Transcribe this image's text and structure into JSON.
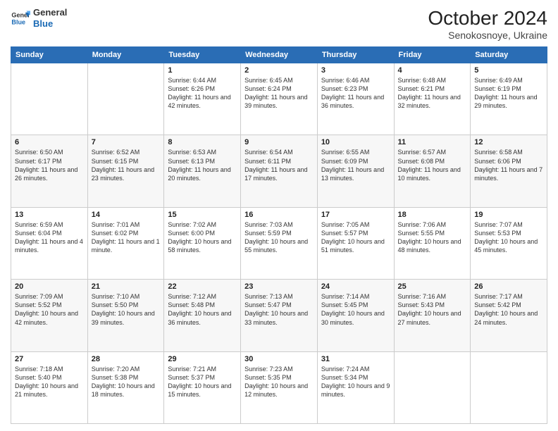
{
  "logo": {
    "line1": "General",
    "line2": "Blue"
  },
  "title": "October 2024",
  "location": "Senokosnoye, Ukraine",
  "days_of_week": [
    "Sunday",
    "Monday",
    "Tuesday",
    "Wednesday",
    "Thursday",
    "Friday",
    "Saturday"
  ],
  "weeks": [
    [
      {
        "day": "",
        "info": ""
      },
      {
        "day": "",
        "info": ""
      },
      {
        "day": "1",
        "info": "Sunrise: 6:44 AM\nSunset: 6:26 PM\nDaylight: 11 hours and 42 minutes."
      },
      {
        "day": "2",
        "info": "Sunrise: 6:45 AM\nSunset: 6:24 PM\nDaylight: 11 hours and 39 minutes."
      },
      {
        "day": "3",
        "info": "Sunrise: 6:46 AM\nSunset: 6:23 PM\nDaylight: 11 hours and 36 minutes."
      },
      {
        "day": "4",
        "info": "Sunrise: 6:48 AM\nSunset: 6:21 PM\nDaylight: 11 hours and 32 minutes."
      },
      {
        "day": "5",
        "info": "Sunrise: 6:49 AM\nSunset: 6:19 PM\nDaylight: 11 hours and 29 minutes."
      }
    ],
    [
      {
        "day": "6",
        "info": "Sunrise: 6:50 AM\nSunset: 6:17 PM\nDaylight: 11 hours and 26 minutes."
      },
      {
        "day": "7",
        "info": "Sunrise: 6:52 AM\nSunset: 6:15 PM\nDaylight: 11 hours and 23 minutes."
      },
      {
        "day": "8",
        "info": "Sunrise: 6:53 AM\nSunset: 6:13 PM\nDaylight: 11 hours and 20 minutes."
      },
      {
        "day": "9",
        "info": "Sunrise: 6:54 AM\nSunset: 6:11 PM\nDaylight: 11 hours and 17 minutes."
      },
      {
        "day": "10",
        "info": "Sunrise: 6:55 AM\nSunset: 6:09 PM\nDaylight: 11 hours and 13 minutes."
      },
      {
        "day": "11",
        "info": "Sunrise: 6:57 AM\nSunset: 6:08 PM\nDaylight: 11 hours and 10 minutes."
      },
      {
        "day": "12",
        "info": "Sunrise: 6:58 AM\nSunset: 6:06 PM\nDaylight: 11 hours and 7 minutes."
      }
    ],
    [
      {
        "day": "13",
        "info": "Sunrise: 6:59 AM\nSunset: 6:04 PM\nDaylight: 11 hours and 4 minutes."
      },
      {
        "day": "14",
        "info": "Sunrise: 7:01 AM\nSunset: 6:02 PM\nDaylight: 11 hours and 1 minute."
      },
      {
        "day": "15",
        "info": "Sunrise: 7:02 AM\nSunset: 6:00 PM\nDaylight: 10 hours and 58 minutes."
      },
      {
        "day": "16",
        "info": "Sunrise: 7:03 AM\nSunset: 5:59 PM\nDaylight: 10 hours and 55 minutes."
      },
      {
        "day": "17",
        "info": "Sunrise: 7:05 AM\nSunset: 5:57 PM\nDaylight: 10 hours and 51 minutes."
      },
      {
        "day": "18",
        "info": "Sunrise: 7:06 AM\nSunset: 5:55 PM\nDaylight: 10 hours and 48 minutes."
      },
      {
        "day": "19",
        "info": "Sunrise: 7:07 AM\nSunset: 5:53 PM\nDaylight: 10 hours and 45 minutes."
      }
    ],
    [
      {
        "day": "20",
        "info": "Sunrise: 7:09 AM\nSunset: 5:52 PM\nDaylight: 10 hours and 42 minutes."
      },
      {
        "day": "21",
        "info": "Sunrise: 7:10 AM\nSunset: 5:50 PM\nDaylight: 10 hours and 39 minutes."
      },
      {
        "day": "22",
        "info": "Sunrise: 7:12 AM\nSunset: 5:48 PM\nDaylight: 10 hours and 36 minutes."
      },
      {
        "day": "23",
        "info": "Sunrise: 7:13 AM\nSunset: 5:47 PM\nDaylight: 10 hours and 33 minutes."
      },
      {
        "day": "24",
        "info": "Sunrise: 7:14 AM\nSunset: 5:45 PM\nDaylight: 10 hours and 30 minutes."
      },
      {
        "day": "25",
        "info": "Sunrise: 7:16 AM\nSunset: 5:43 PM\nDaylight: 10 hours and 27 minutes."
      },
      {
        "day": "26",
        "info": "Sunrise: 7:17 AM\nSunset: 5:42 PM\nDaylight: 10 hours and 24 minutes."
      }
    ],
    [
      {
        "day": "27",
        "info": "Sunrise: 7:18 AM\nSunset: 5:40 PM\nDaylight: 10 hours and 21 minutes."
      },
      {
        "day": "28",
        "info": "Sunrise: 7:20 AM\nSunset: 5:38 PM\nDaylight: 10 hours and 18 minutes."
      },
      {
        "day": "29",
        "info": "Sunrise: 7:21 AM\nSunset: 5:37 PM\nDaylight: 10 hours and 15 minutes."
      },
      {
        "day": "30",
        "info": "Sunrise: 7:23 AM\nSunset: 5:35 PM\nDaylight: 10 hours and 12 minutes."
      },
      {
        "day": "31",
        "info": "Sunrise: 7:24 AM\nSunset: 5:34 PM\nDaylight: 10 hours and 9 minutes."
      },
      {
        "day": "",
        "info": ""
      },
      {
        "day": "",
        "info": ""
      }
    ]
  ]
}
